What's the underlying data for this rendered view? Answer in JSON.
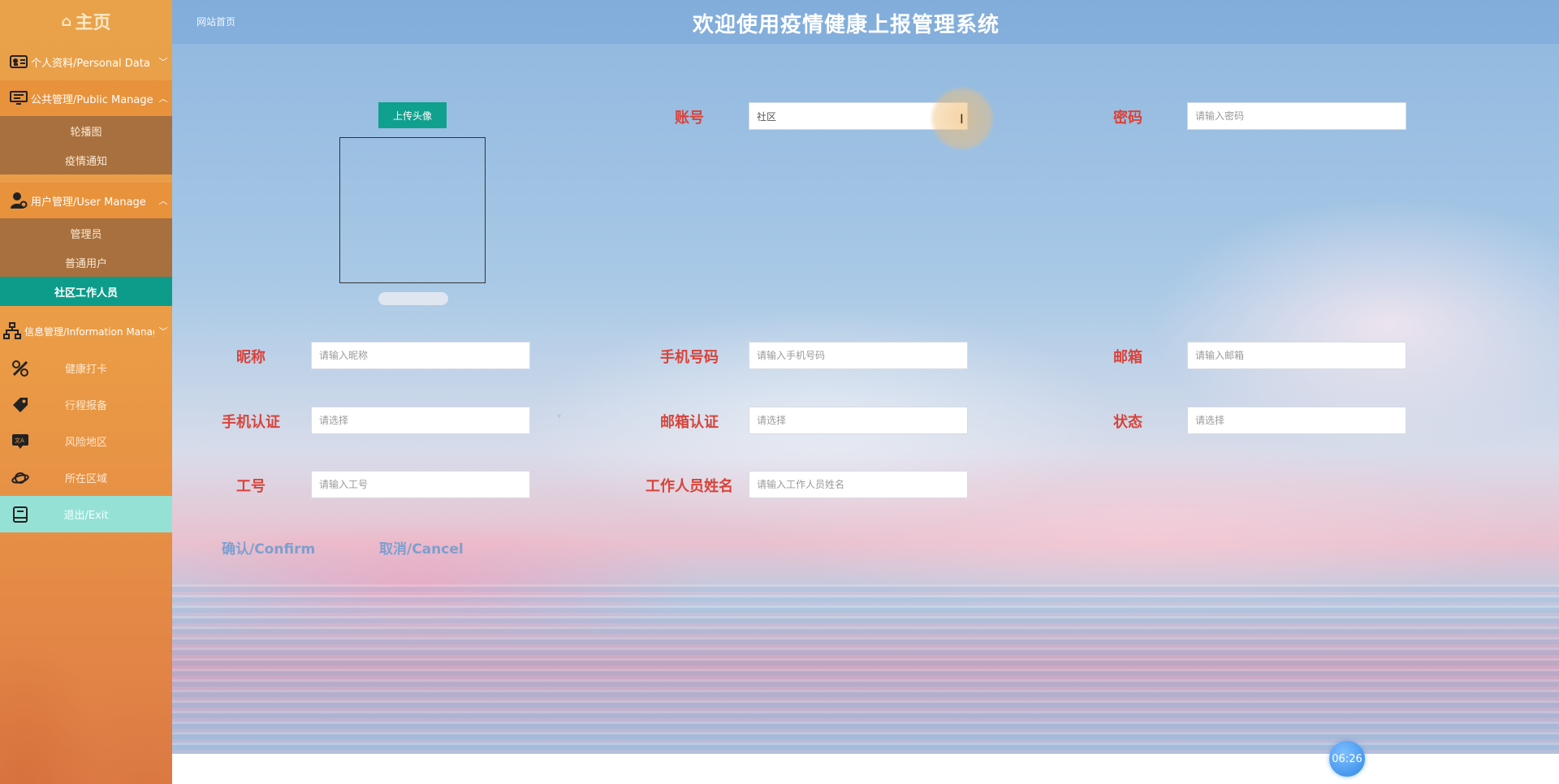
{
  "sidebar": {
    "brand": "主页",
    "menus": [
      {
        "label": "个人资料/Personal Data",
        "icon": "id-card-icon",
        "expanded": false
      },
      {
        "label": "公共管理/Public Manage",
        "icon": "monitor-icon",
        "expanded": true,
        "items": [
          "轮播图",
          "疫情通知"
        ]
      },
      {
        "label": "用户管理/User Manage",
        "icon": "user-gear-icon",
        "expanded": true,
        "items": [
          "管理员",
          "普通用户",
          "社区工作人员"
        ],
        "active_item": "社区工作人员"
      },
      {
        "label": "信息管理/Information Manage",
        "icon": "hierarchy-icon",
        "expanded": false
      }
    ],
    "plain_items": [
      {
        "label": "健康打卡",
        "icon": "palette-icon"
      },
      {
        "label": "行程报备",
        "icon": "tag-icon"
      },
      {
        "label": "风险地区",
        "icon": "translate-board-icon"
      },
      {
        "label": "所在区域",
        "icon": "planet-icon"
      },
      {
        "label": "退出/Exit",
        "icon": "book-icon"
      }
    ]
  },
  "header": {
    "breadcrumb": "网站首页",
    "title": "欢迎使用疫情健康上报管理系统"
  },
  "form": {
    "upload_label": "上传头像",
    "account": {
      "label": "账号",
      "value": "社区"
    },
    "password": {
      "label": "密码",
      "placeholder": "请输入密码"
    },
    "nickname": {
      "label": "昵称",
      "placeholder": "请输入昵称"
    },
    "phone": {
      "label": "手机号码",
      "placeholder": "请输入手机号码"
    },
    "email": {
      "label": "邮箱",
      "placeholder": "请输入邮箱"
    },
    "phone_verify": {
      "label": "手机认证",
      "placeholder": "请选择"
    },
    "email_verify": {
      "label": "邮箱认证",
      "placeholder": "请选择"
    },
    "status": {
      "label": "状态",
      "placeholder": "请选择"
    },
    "job_no": {
      "label": "工号",
      "placeholder": "请输入工号"
    },
    "staff_name": {
      "label": "工作人员姓名",
      "placeholder": "请输入工作人员姓名"
    },
    "confirm_label": "确认/Confirm",
    "cancel_label": "取消/Cancel"
  },
  "timer": "06:26",
  "colors": {
    "sidebar": "#e9a24a",
    "active": "#0d9c8a",
    "label": "#d8433a",
    "link": "#7d9fcf"
  }
}
